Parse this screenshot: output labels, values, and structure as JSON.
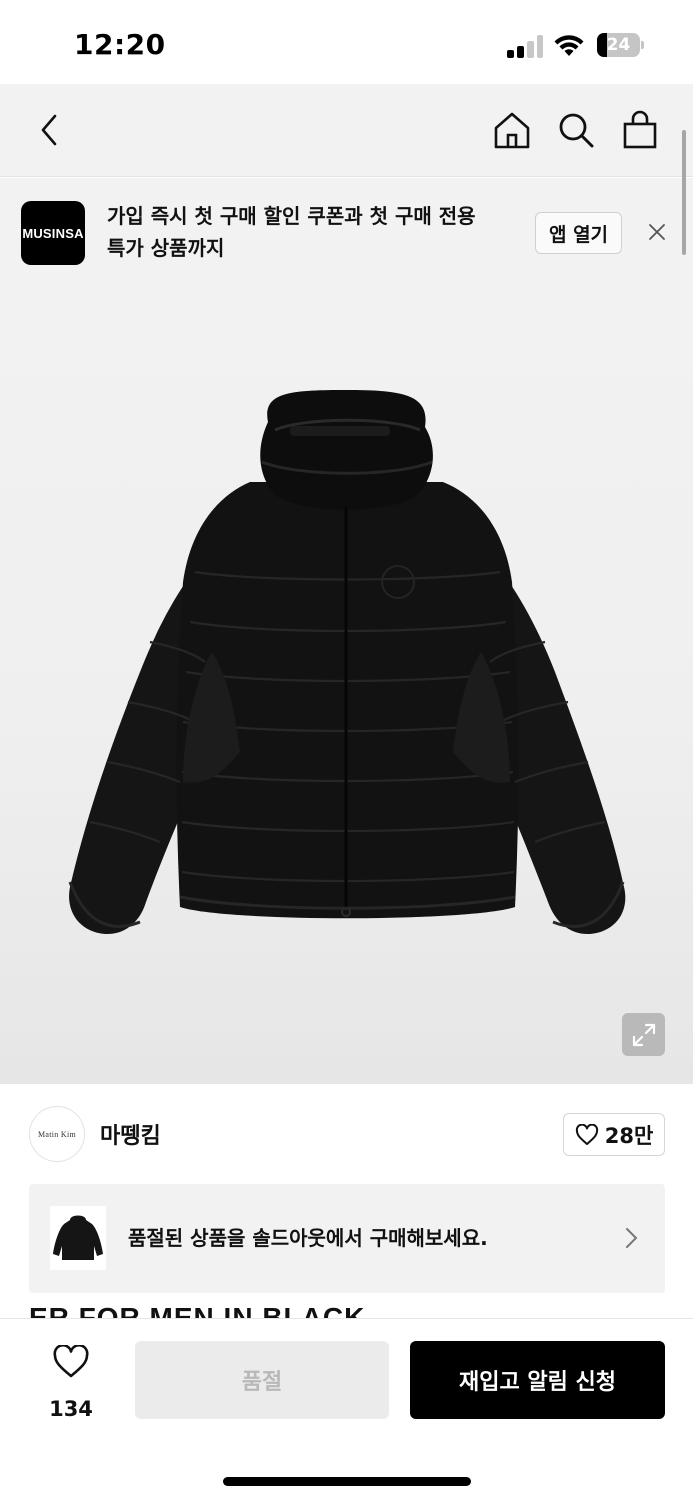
{
  "status_bar": {
    "time": "12:20",
    "battery": "24",
    "battery_level": 0.24
  },
  "nav": {
    "icons": [
      "back-icon",
      "home-icon",
      "search-icon",
      "bag-icon"
    ]
  },
  "promo": {
    "logo": "MUSINSA",
    "text_line1": "가입 즉시 첫 구매 할인 쿠폰과 첫 구매 전용",
    "text_line2": "특가 상품까지",
    "open_label": "앱 열기"
  },
  "brand": {
    "avatar_text": "Matin Kim",
    "name": "마뗑킴",
    "likes": "28만"
  },
  "soldout_card": {
    "text": "품절된 상품을 솔드아웃에서 구매해보세요."
  },
  "product_title_peek": "ER FOR MEN IN BLACK",
  "bottom": {
    "wish_count": "134",
    "soldout_label": "품절",
    "restock_label": "재입고 알림 신청"
  }
}
